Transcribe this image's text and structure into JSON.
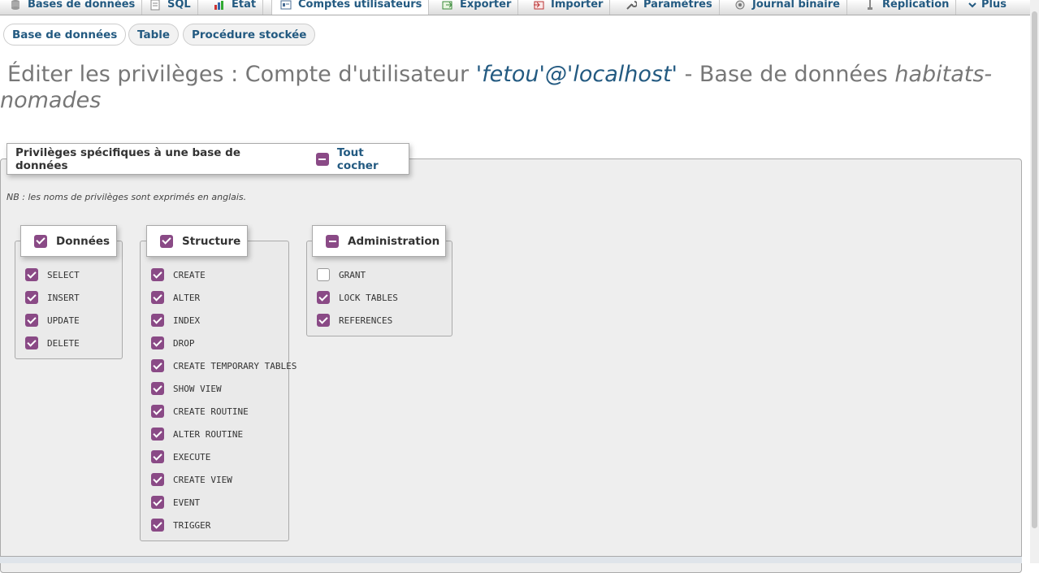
{
  "topnav": {
    "tabs": [
      {
        "label": "Bases de données",
        "icon": "database-icon"
      },
      {
        "label": "SQL",
        "icon": "sql-icon"
      },
      {
        "label": "État",
        "icon": "status-icon"
      },
      {
        "label": "Comptes utilisateurs",
        "icon": "users-icon",
        "active": true
      },
      {
        "label": "Exporter",
        "icon": "export-icon"
      },
      {
        "label": "Importer",
        "icon": "import-icon"
      },
      {
        "label": "Paramètres",
        "icon": "wrench-icon"
      },
      {
        "label": "Journal binaire",
        "icon": "log-icon"
      },
      {
        "label": "Réplication",
        "icon": "replication-icon"
      },
      {
        "label": "Plus",
        "icon": "chevron-down-icon"
      }
    ]
  },
  "subtabs": [
    {
      "label": "Base de données",
      "active": true
    },
    {
      "label": "Table"
    },
    {
      "label": "Procédure stockée"
    }
  ],
  "title": {
    "prefix": "Éditer les privilèges : Compte d'utilisateur",
    "user": "'fetou'@'localhost'",
    "middle": "- Base de données",
    "database": "habitats-nomades"
  },
  "privileges": {
    "legend": "Privilèges spécifiques à une base de données",
    "check_all_label": "Tout cocher",
    "check_all_state": "indeterminate",
    "note": "NB : les noms de privilèges sont exprimés en anglais.",
    "groups": [
      {
        "title": "Données",
        "state": "checked",
        "items": [
          {
            "label": "SELECT",
            "checked": true
          },
          {
            "label": "INSERT",
            "checked": true
          },
          {
            "label": "UPDATE",
            "checked": true
          },
          {
            "label": "DELETE",
            "checked": true
          }
        ]
      },
      {
        "title": "Structure",
        "state": "checked",
        "items": [
          {
            "label": "CREATE",
            "checked": true
          },
          {
            "label": "ALTER",
            "checked": true
          },
          {
            "label": "INDEX",
            "checked": true
          },
          {
            "label": "DROP",
            "checked": true
          },
          {
            "label": "CREATE TEMPORARY TABLES",
            "checked": true
          },
          {
            "label": "SHOW VIEW",
            "checked": true
          },
          {
            "label": "CREATE ROUTINE",
            "checked": true
          },
          {
            "label": "ALTER ROUTINE",
            "checked": true
          },
          {
            "label": "EXECUTE",
            "checked": true
          },
          {
            "label": "CREATE VIEW",
            "checked": true
          },
          {
            "label": "EVENT",
            "checked": true
          },
          {
            "label": "TRIGGER",
            "checked": true
          }
        ]
      },
      {
        "title": "Administration",
        "state": "indeterminate",
        "items": [
          {
            "label": "GRANT",
            "checked": false
          },
          {
            "label": "LOCK TABLES",
            "checked": true
          },
          {
            "label": "REFERENCES",
            "checked": true
          }
        ]
      }
    ]
  },
  "colors": {
    "accent": "#8a4a86",
    "link": "#235a81",
    "panel": "#eeeeee"
  }
}
